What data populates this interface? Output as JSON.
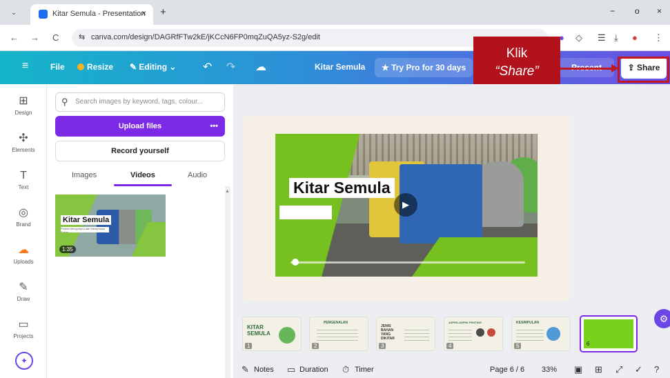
{
  "browser": {
    "tab_title": "Kitar Semula - Presentation",
    "tab_close": "×",
    "new_tab": "+",
    "menu": "⌄",
    "minimize": "−",
    "maximize": "o",
    "close": "×",
    "back": "←",
    "forward": "→",
    "reload": "C",
    "site_icon": "⇆",
    "url": "canva.com/design/DAGRfFTw2kE/jKCcN6FP0mqZuQA5yz-S2g/edit"
  },
  "header": {
    "menu_icon": "≡",
    "file": "File",
    "resize": "Resize",
    "editing": "Editing",
    "undo": "↶",
    "redo": "↷",
    "save_status_icon": "☁",
    "doc_title": "Kitar Semula",
    "try_pro": "★ Try Pro for 30 days",
    "present": "Present",
    "share": "Share",
    "share_icon": "⇪"
  },
  "callout": {
    "line1": "Klik",
    "line2": "“Share”",
    "color": "#b1121c"
  },
  "rail": {
    "items": [
      {
        "icon": "⊞",
        "label": "Design"
      },
      {
        "icon": "✣",
        "label": "Elements"
      },
      {
        "icon": "T",
        "label": "Text"
      },
      {
        "icon": "◎",
        "label": "Brand"
      },
      {
        "icon": "☁",
        "label": "Uploads"
      },
      {
        "icon": "✎",
        "label": "Draw"
      },
      {
        "icon": "▭",
        "label": "Projects"
      }
    ],
    "magic_icon": "✦"
  },
  "panel": {
    "search_placeholder": "Search images by keyword, tags, colour...",
    "upload_label": "Upload files",
    "upload_more": "•••",
    "record_label": "Record yourself",
    "tabs": [
      "Images",
      "Videos",
      "Audio"
    ],
    "active_tab": "Videos",
    "video": {
      "title": "Kitar Semula",
      "subtitle": "Proses Mengumpul dan Memproses Bahan",
      "duration": "1:35"
    }
  },
  "slide": {
    "title": "Kitar Semula",
    "play_icon": "▶",
    "video_progress": 0.02
  },
  "pages": {
    "thumbs": [
      {
        "num": "1",
        "text": "KITAR\nSEMULA"
      },
      {
        "num": "2",
        "text": "PENGENALAN"
      },
      {
        "num": "3",
        "text": "JENIS\nBAHAN\nYANG\nDIKITAR"
      },
      {
        "num": "4",
        "text": "ASPEK-ASPEK PENTING"
      },
      {
        "num": "5",
        "text": "KESIMPULAN"
      }
    ],
    "active_num": "6"
  },
  "footer": {
    "notes": "Notes",
    "duration": "Duration",
    "timer": "Timer",
    "page": "Page 6 / 6",
    "zoom": "33%"
  },
  "colors": {
    "accent_purple": "#7d2ae8",
    "brand_green": "#76c11f",
    "highlight_red": "#c0161f"
  }
}
